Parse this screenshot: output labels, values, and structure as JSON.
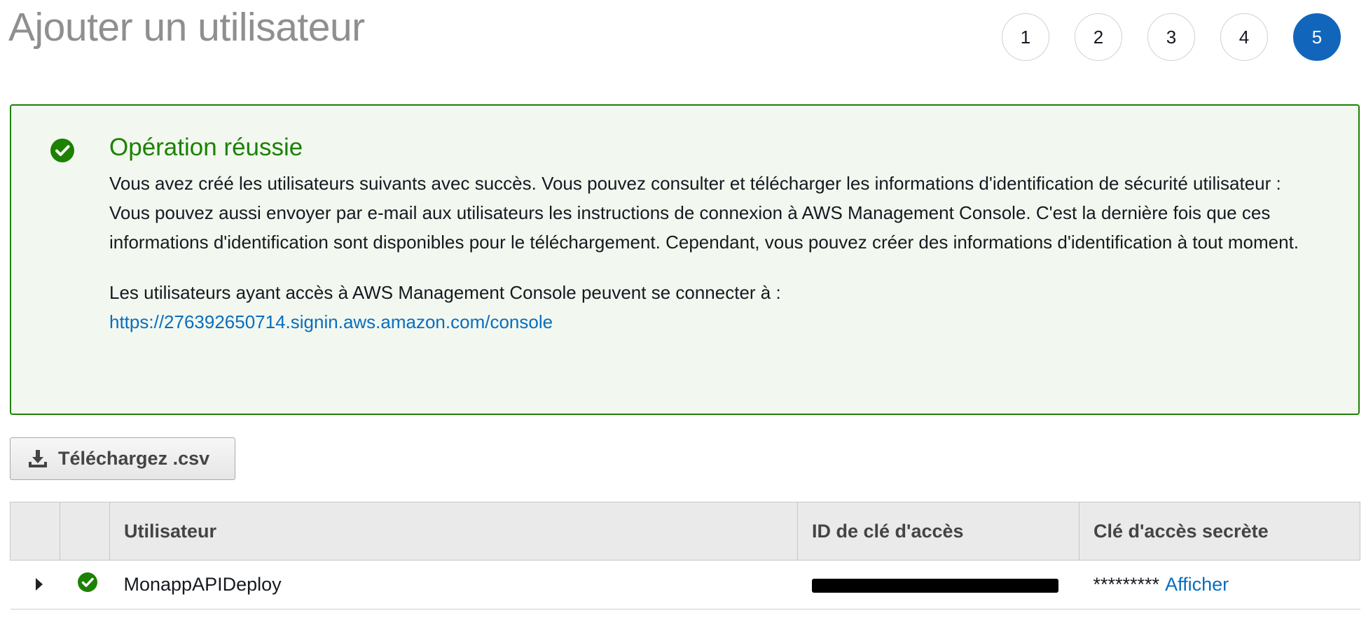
{
  "page": {
    "title": "Ajouter un utilisateur"
  },
  "steps": [
    {
      "label": "1",
      "active": false
    },
    {
      "label": "2",
      "active": false
    },
    {
      "label": "3",
      "active": false
    },
    {
      "label": "4",
      "active": false
    },
    {
      "label": "5",
      "active": true
    }
  ],
  "success": {
    "title": "Opération réussie",
    "message": "Vous avez créé les utilisateurs suivants avec succès. Vous pouvez consulter et télécharger les informations d'identification de sécurité utilisateur : Vous pouvez aussi envoyer par e-mail aux utilisateurs les instructions de connexion à AWS Management Console. C'est la dernière fois que ces informations d'identification sont disponibles pour le téléchargement. Cependant, vous pouvez créer des informations d'identification à tout moment.",
    "signin_text": "Les utilisateurs ayant accès à AWS Management Console peuvent se connecter à :",
    "signin_url": "https://276392650714.signin.aws.amazon.com/console"
  },
  "download_button": {
    "label": "Téléchargez .csv"
  },
  "table": {
    "columns": [
      "",
      "",
      "Utilisateur",
      "ID de clé d'accès",
      "Clé d'accès secrète"
    ],
    "rows": [
      {
        "user": "MonappAPIDeploy",
        "access_key_id": "",
        "secret_mask": "*********",
        "show_label": "Afficher"
      }
    ]
  },
  "colors": {
    "success": "#1d8102",
    "link": "#0a6dbd",
    "active_step": "#1166bb"
  }
}
